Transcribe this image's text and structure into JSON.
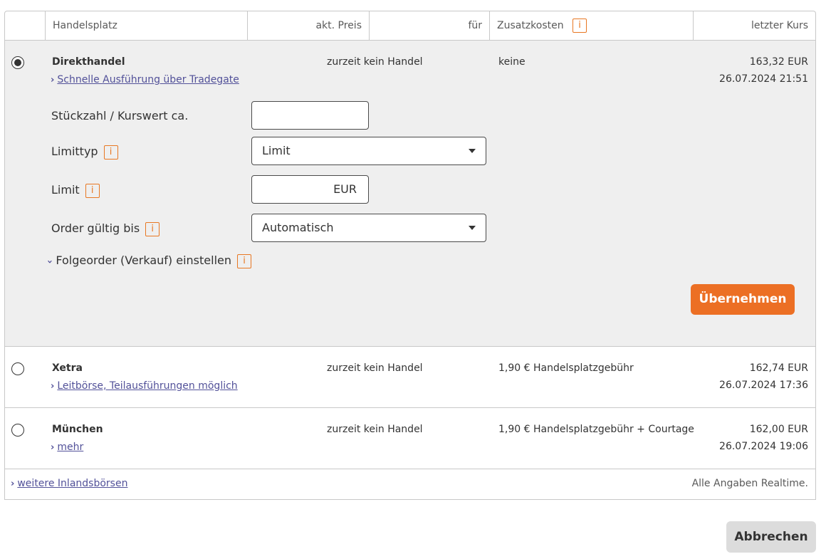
{
  "header": {
    "col_handelsplatz": "Handelsplatz",
    "col_akt_preis": "akt. Preis",
    "col_fuer": "für",
    "col_zusatzkosten": "Zusatzkosten",
    "col_letzter_kurs": "letzter Kurs",
    "info_glyph": "i"
  },
  "markets": [
    {
      "name": "Direkthandel",
      "link": "Schnelle Ausführung über Tradegate",
      "price": "zurzeit kein Handel",
      "cost": "keine",
      "last_price": "163,32 EUR",
      "last_time": "26.07.2024 21:51",
      "selected": true
    },
    {
      "name": "Xetra",
      "link": "Leitbörse, Teilausführungen möglich",
      "price": "zurzeit kein Handel",
      "cost": "1,90 € Handelsplatzgebühr",
      "last_price": "162,74 EUR",
      "last_time": "26.07.2024 17:36",
      "selected": false
    },
    {
      "name": "München",
      "link": "mehr",
      "price": "zurzeit kein Handel",
      "cost": "1,90 € Handelsplatzgebühr + Courtage",
      "last_price": "162,00 EUR",
      "last_time": "26.07.2024 19:06",
      "selected": false
    }
  ],
  "form": {
    "quantity_label": "Stückzahl / Kurswert ca.",
    "quantity_value": "",
    "limit_type_label": "Limittyp",
    "limit_type_value": "Limit",
    "limit_label": "Limit",
    "limit_value": "",
    "limit_unit": "EUR",
    "valid_until_label": "Order gültig bis",
    "valid_until_value": "Automatisch",
    "follow_order_label": "Folgeorder (Verkauf) einstellen",
    "apply_button": "Übernehmen"
  },
  "footer": {
    "more_exchanges_link": "weitere Inlandsbörsen",
    "realtime_note": "Alle Angaben Realtime."
  },
  "actions": {
    "cancel_button": "Abbrechen"
  },
  "colors": {
    "accent_orange": "#ec6f24",
    "link_purple": "#525199",
    "panel_grey": "#efefef"
  },
  "icons": {
    "info": "info-icon",
    "chevron_right": "chevron-right-icon",
    "chevron_down": "chevron-down-icon",
    "dropdown_caret": "caret-down-icon"
  }
}
